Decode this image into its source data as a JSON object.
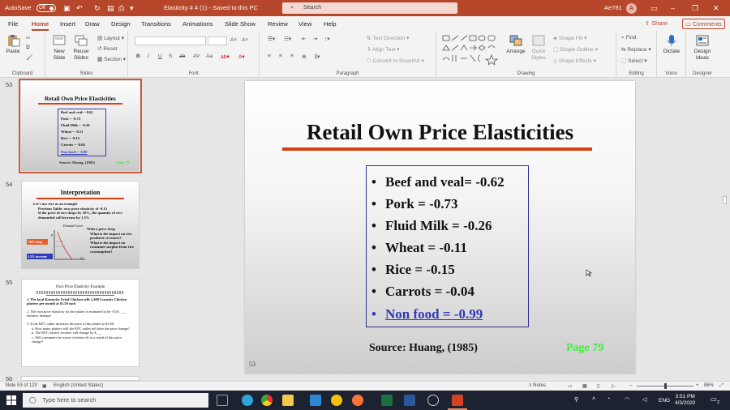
{
  "titlebar": {
    "autosave": "AutoSave",
    "autosave_state": "Off",
    "document_title": "Elasticity # 4 (1) - Saved to this PC",
    "search_placeholder": "Search",
    "user_name": "Ae781",
    "user_initial": "A"
  },
  "tabs": [
    "File",
    "Home",
    "Insert",
    "Draw",
    "Design",
    "Transitions",
    "Animations",
    "Slide Show",
    "Review",
    "View",
    "Help"
  ],
  "active_tab": "Home",
  "share_label": "Share",
  "comments_label": "Comments",
  "ribbon": {
    "groups": [
      "Clipboard",
      "Slides",
      "Font",
      "Paragraph",
      "Drawing",
      "Editing",
      "Voice",
      "Designer"
    ],
    "paste": "Paste",
    "new_slide": "New Slide",
    "reuse_slides": "Reuse Slides",
    "layout": "Layout",
    "reset": "Reset",
    "section": "Section",
    "text_direction": "Text Direction",
    "align_text": "Align Text",
    "convert_smartart": "Convert to SmartArt",
    "arrange": "Arrange",
    "quick_styles": "Quick Styles",
    "shape_fill": "Shape Fill",
    "shape_outline": "Shape Outline",
    "shape_effects": "Shape Effects",
    "find": "Find",
    "replace": "Replace",
    "select": "Select",
    "dictate": "Dictate",
    "design_ideas": "Design Ideas"
  },
  "thumbnails": [
    {
      "number": "53",
      "title": "Retail Own Price Elasticities",
      "bullets": [
        "Beef and veal= -0.62",
        "Pork = -0.73",
        "Fluid Milk = -0.26",
        "Wheat = -0.11",
        "Rice = -0.15",
        "Carrots = -0.04",
        "Non food = -0.99"
      ],
      "source": "Source: Huang, (1985)",
      "page": "Page 79"
    },
    {
      "number": "54",
      "title": "Interpretation",
      "lines": [
        "Let's use rice as an example",
        "Previous Table: own price elasticity of -0.15",
        "If the price of rice drops by 10%, the quantity of rice demanded will increase by 1.5%"
      ],
      "graph_labels": [
        "Demand Curve",
        "10% drop",
        "1.5% increase",
        "P",
        "Q"
      ],
      "side_lines": [
        "With a price drop",
        "What is the impact on rice producer revenues?",
        "What is the impact on consumer surplus from rice consumption?"
      ]
    },
    {
      "number": "55",
      "title": "Own Price Elasticity Example",
      "lines": [
        "1. The local Kentucky Fried Chicken sells 1,400 Crunchy Chicken platters per month at $1.50 each",
        "2. The own price elasticity for the platter is estimated to be -0.50, ___ inelastic demand",
        "3. If the KFC outlet increases the price of the platter to $1.60:",
        "a. How many platters will the KFC outlet sell after the price change?",
        "b. The KFC outlet's revenue will change by $___",
        "c. Will consumers be worse or better off as a result of this price change?"
      ]
    },
    {
      "number": "56"
    }
  ],
  "slide": {
    "title": "Retail Own Price Elasticities",
    "bullets": [
      "Beef  and veal= -0.62",
      "Pork = -0.73",
      "Fluid Milk = -0.26",
      "Wheat = -0.11",
      "Rice = -0.15",
      "Carrots = -0.04"
    ],
    "link_bullet": "Non food = -0.99",
    "source": "Source:  Huang, (1985)",
    "page": "Page 79",
    "number": "53"
  },
  "statusbar": {
    "slide_count": "Slide 53 of 120",
    "language": "English (United States)",
    "notes": "Notes",
    "zoom": "86%"
  },
  "taskbar": {
    "search_placeholder": "Type here to search",
    "lang": "ENG",
    "time": "3:51 PM",
    "date": "4/3/2020",
    "notification_count": "2"
  },
  "colors": {
    "accent": "#b7472a",
    "slide_rule": "#d8400f",
    "box_border": "#2e3192",
    "page_green": "#3df03d"
  }
}
